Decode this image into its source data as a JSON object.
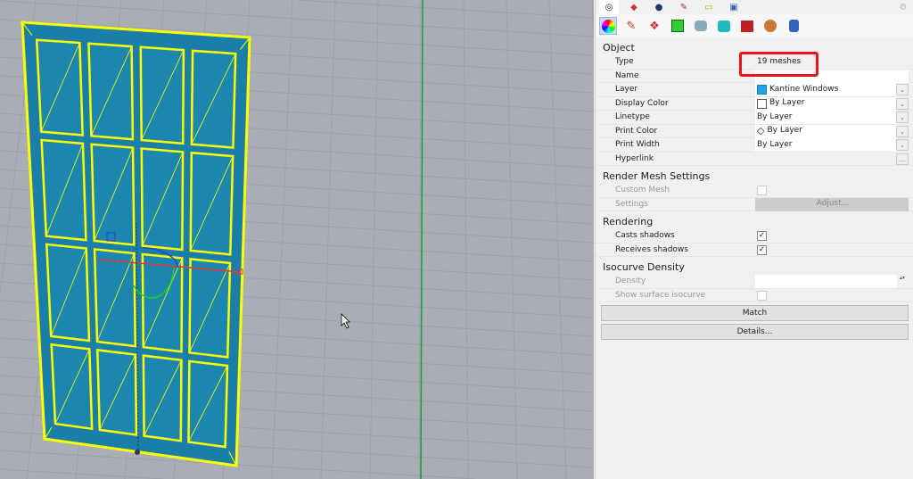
{
  "panel": {
    "sections": {
      "object": "Object",
      "render_mesh": "Render Mesh Settings",
      "rendering": "Rendering",
      "isocurve": "Isocurve Density"
    },
    "rows": {
      "type": {
        "label": "Type",
        "value": "19 meshes"
      },
      "name": {
        "label": "Name",
        "value": ""
      },
      "layer": {
        "label": "Layer",
        "value": "Kantine Windows"
      },
      "display_color": {
        "label": "Display Color",
        "value": "By Layer"
      },
      "linetype": {
        "label": "Linetype",
        "value": "By Layer"
      },
      "print_color": {
        "label": "Print Color",
        "value": "By Layer"
      },
      "print_width": {
        "label": "Print Width",
        "value": "By Layer"
      },
      "hyperlink": {
        "label": "Hyperlink",
        "button": "..."
      },
      "custom_mesh": {
        "label": "Custom Mesh"
      },
      "settings": {
        "label": "Settings",
        "button": "Adjust..."
      },
      "casts_shadows": {
        "label": "Casts shadows",
        "checked": true
      },
      "receives_shadows": {
        "label": "Receives shadows",
        "checked": true
      },
      "density": {
        "label": "Density",
        "value": ""
      },
      "show_isocurve": {
        "label": "Show surface isocurve",
        "checked": false
      }
    },
    "buttons": {
      "match": "Match",
      "details": "Details..."
    },
    "layer_color": "#1aa6e8",
    "check": "✓",
    "dropdown": "⌄",
    "spinner": "▴▾"
  },
  "colors": {
    "wire": "#ffff00",
    "fill": "#1a7fa8",
    "highlight": "#e8141b"
  }
}
